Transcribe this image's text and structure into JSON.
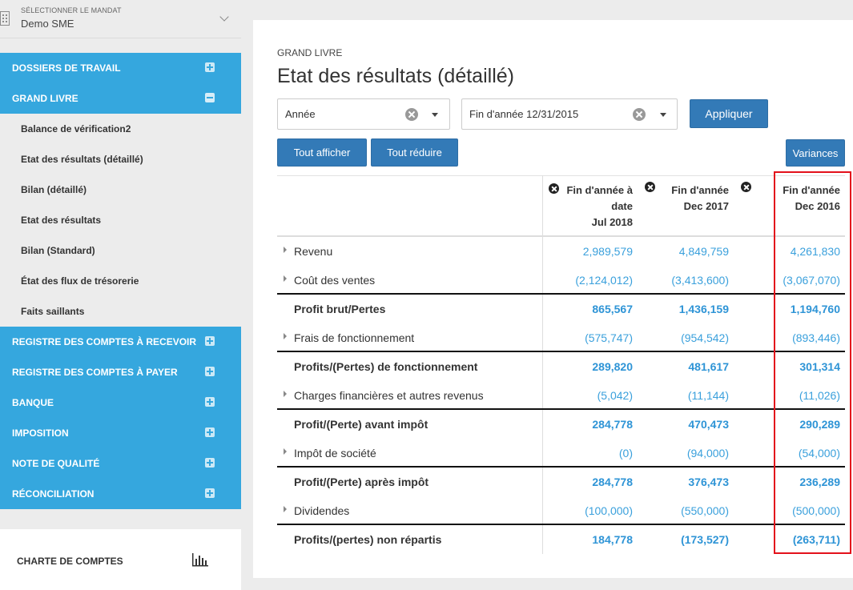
{
  "mandat": {
    "label": "SÉLECTIONNER LE MANDAT",
    "value": "Demo SME"
  },
  "nav": [
    {
      "label": "DOSSIERS DE TRAVAIL",
      "kind": "section",
      "toggle": "plus"
    },
    {
      "label": "GRAND LIVRE",
      "kind": "section",
      "toggle": "minus"
    },
    {
      "label": "Balance de vérification2",
      "kind": "sub"
    },
    {
      "label": "Etat des résultats (détaillé)",
      "kind": "sub"
    },
    {
      "label": "Bilan (détaillé)",
      "kind": "sub"
    },
    {
      "label": "Etat des résultats",
      "kind": "sub"
    },
    {
      "label": "Bilan (Standard)",
      "kind": "sub"
    },
    {
      "label": "État des flux de trésorerie",
      "kind": "sub"
    },
    {
      "label": "Faits saillants",
      "kind": "sub"
    },
    {
      "label": "REGISTRE DES COMPTES À RECEVOIR",
      "kind": "section",
      "toggle": "plus"
    },
    {
      "label": "REGISTRE DES COMPTES À PAYER",
      "kind": "section",
      "toggle": "plus"
    },
    {
      "label": "BANQUE",
      "kind": "section",
      "toggle": "plus"
    },
    {
      "label": "IMPOSITION",
      "kind": "section",
      "toggle": "plus"
    },
    {
      "label": "NOTE DE QUALITÉ",
      "kind": "section",
      "toggle": "plus"
    },
    {
      "label": "RÉCONCILIATION",
      "kind": "section",
      "toggle": "plus"
    }
  ],
  "charte": {
    "label": "CHARTE DE COMPTES",
    "icon": "bar-chart-icon"
  },
  "page": {
    "breadcrumb": "GRAND LIVRE",
    "title": "Etat des résultats (détaillé)"
  },
  "filters": {
    "period": "Année",
    "date": "Fin d'année 12/31/2015",
    "apply": "Appliquer"
  },
  "buttons": {
    "expand_all": "Tout afficher",
    "collapse_all": "Tout réduire",
    "variances": "Variances"
  },
  "columns": [
    {
      "lines": [
        "Fin d'année à",
        "date",
        "Jul 2018"
      ]
    },
    {
      "lines": [
        "Fin d'année",
        "Dec 2017"
      ]
    },
    {
      "lines": [
        "Fin d'année",
        "Dec 2016"
      ]
    }
  ],
  "rows": [
    {
      "label": "Revenu",
      "expandable": true,
      "total": false,
      "values": [
        "2,989,579",
        "4,849,759",
        "4,261,830"
      ]
    },
    {
      "label": "Coût des ventes",
      "expandable": true,
      "total": false,
      "values": [
        "(2,124,012)",
        "(3,413,600)",
        "(3,067,070)"
      ]
    },
    {
      "label": "Profit brut/Pertes",
      "expandable": false,
      "total": true,
      "values": [
        "865,567",
        "1,436,159",
        "1,194,760"
      ]
    },
    {
      "label": "Frais de fonctionnement",
      "expandable": true,
      "total": false,
      "values": [
        "(575,747)",
        "(954,542)",
        "(893,446)"
      ]
    },
    {
      "label": "Profits/(Pertes) de fonctionnement",
      "expandable": false,
      "total": true,
      "values": [
        "289,820",
        "481,617",
        "301,314"
      ]
    },
    {
      "label": "Charges financières et autres revenus",
      "expandable": true,
      "total": false,
      "values": [
        "(5,042)",
        "(11,144)",
        "(11,026)"
      ]
    },
    {
      "label": "Profit/(Perte) avant impôt",
      "expandable": false,
      "total": true,
      "values": [
        "284,778",
        "470,473",
        "290,289"
      ]
    },
    {
      "label": "Impôt de société",
      "expandable": true,
      "total": false,
      "values": [
        "(0)",
        "(94,000)",
        "(54,000)"
      ]
    },
    {
      "label": "Profit/(Perte) après impôt",
      "expandable": false,
      "total": true,
      "values": [
        "284,778",
        "376,473",
        "236,289"
      ]
    },
    {
      "label": "Dividendes",
      "expandable": true,
      "total": false,
      "values": [
        "(100,000)",
        "(550,000)",
        "(500,000)"
      ]
    },
    {
      "label": "Profits/(pertes) non répartis",
      "expandable": false,
      "total": true,
      "values": [
        "184,778",
        "(173,527)",
        "(263,711)"
      ]
    }
  ],
  "colors": {
    "sidebar_active": "#35a7de",
    "button": "#337ab7",
    "value": "#3aa0dc",
    "highlight": "#e3111b"
  }
}
